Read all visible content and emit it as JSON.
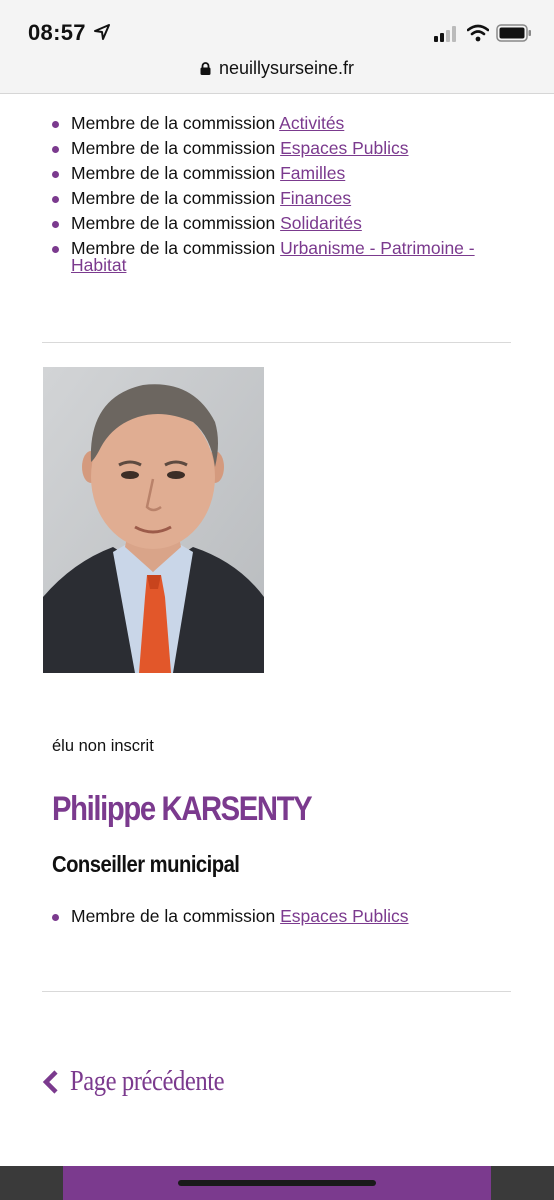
{
  "status_bar": {
    "time": "08:57"
  },
  "browser": {
    "url": "neuillysurseine.fr"
  },
  "previous_member": {
    "commissions": [
      {
        "prefix": "Membre de la commission ",
        "link": "Activités"
      },
      {
        "prefix": "Membre de la commission ",
        "link": "Espaces Publics"
      },
      {
        "prefix": "Membre de la commission ",
        "link": "Familles"
      },
      {
        "prefix": "Membre de la commission ",
        "link": "Finances"
      },
      {
        "prefix": "Membre de la commission ",
        "link": "Solidarités"
      },
      {
        "prefix": "Membre de la commission ",
        "link": "Urbanisme - Patrimoine - Habitat"
      }
    ]
  },
  "member": {
    "party": "élu non inscrit",
    "name": "Philippe KARSENTY",
    "role": "Conseiller municipal",
    "commissions": [
      {
        "prefix": "Membre de la commission ",
        "link": "Espaces Publics"
      }
    ]
  },
  "navigation": {
    "back_label": "Page précédente"
  },
  "colors": {
    "accent": "#7b3a8e",
    "footer": "#3a3a3a"
  }
}
